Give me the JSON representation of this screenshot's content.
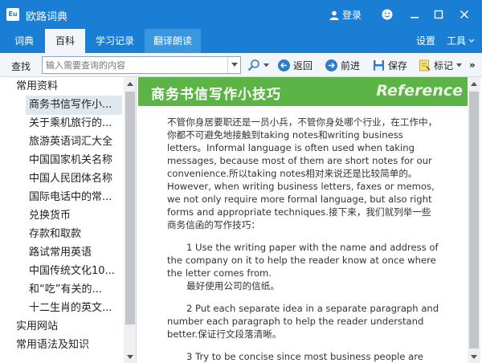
{
  "window": {
    "title": "欧路词典",
    "logo_text": "Eu",
    "login_label": "登录"
  },
  "menu": {
    "tabs": [
      {
        "label": "词典"
      },
      {
        "label": "百科"
      },
      {
        "label": "学习记录"
      },
      {
        "label": "翻译朗读"
      }
    ],
    "settings_label": "设置",
    "tools_label": "工具"
  },
  "toolbar": {
    "find_label": "查找",
    "search_placeholder": "输入需要查询的内容",
    "back_label": "返回",
    "forward_label": "前进",
    "save_label": "保存",
    "bookmark_label": "标记"
  },
  "sidebar": {
    "items": [
      {
        "label": "常用资料",
        "level": "category"
      },
      {
        "label": "商务书信写作小...",
        "level": "sub",
        "selected": true
      },
      {
        "label": "关于乘机旅行的...",
        "level": "sub"
      },
      {
        "label": "旅游英语词汇大全",
        "level": "sub"
      },
      {
        "label": "中国国家机关名称",
        "level": "sub"
      },
      {
        "label": "中国人民团体名称",
        "level": "sub"
      },
      {
        "label": "国际电话中的常...",
        "level": "sub"
      },
      {
        "label": "兑换货币",
        "level": "sub"
      },
      {
        "label": "存款和取款",
        "level": "sub"
      },
      {
        "label": "路试常用英语",
        "level": "sub"
      },
      {
        "label": "中国传统文化10...",
        "level": "sub"
      },
      {
        "label": "和“吃”有关的...",
        "level": "sub"
      },
      {
        "label": "十二生肖的英文...",
        "level": "sub"
      },
      {
        "label": "实用网站",
        "level": "category"
      },
      {
        "label": "常用语法及知识",
        "level": "category"
      }
    ]
  },
  "article": {
    "title": "商务书信写作小技巧",
    "reference": "Reference",
    "intro": "不管你身居要职还是一员小兵，不管你身处哪个行业，在工作中，你都不可避免地接触到taking notes和writing business letters。Informal language is often used when taking messages, because most of them are short notes for our convenience.所以taking notes相对来说还是比较简单的。However, when writing business letters, faxes or memos, we not only require more formal language, but also right forms and appropriate techniques.接下来，我们就列举一些商务信函的写作技巧：",
    "tip1_en": "1 Use the writing paper with the name and address of the company on it to help the reader know at once where the letter comes from.",
    "tip1_zh": "最好使用公司的信纸。",
    "tip2": "2 Put each separate idea in a separate paragraph and number each paragraph to help the reader understand better.保证行文段落清晰。",
    "tip3": "3 Try to be concise since most business people are"
  },
  "colors": {
    "title_bar": "#1a7fd4",
    "banner": "#5bb445",
    "selected_item": "#dfe7ef"
  }
}
